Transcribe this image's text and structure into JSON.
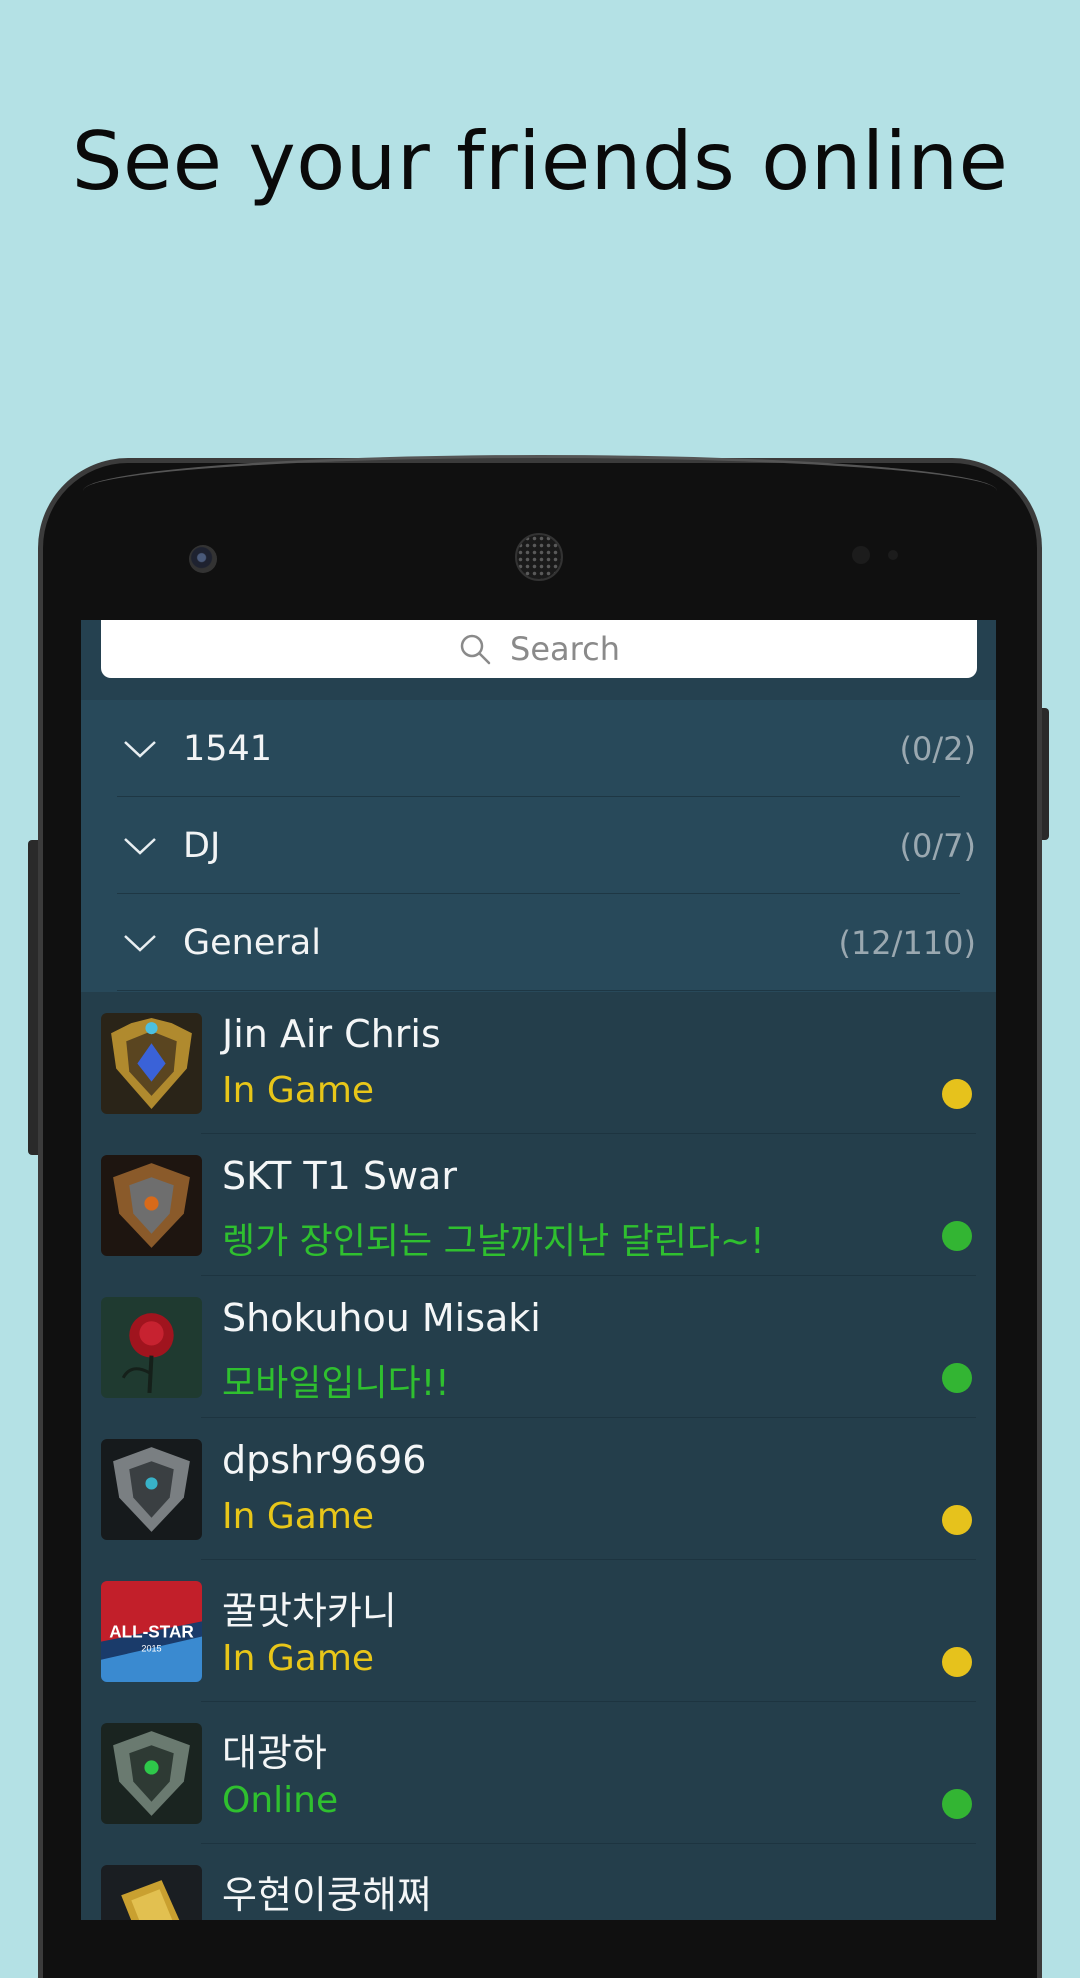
{
  "headline": "See your friends online",
  "search": {
    "placeholder": "Search",
    "icon": "search-icon"
  },
  "groups": [
    {
      "name": "1541",
      "count": "(0/2)"
    },
    {
      "name": "DJ",
      "count": "(0/7)"
    },
    {
      "name": "General",
      "count": "(12/110)"
    }
  ],
  "friends": [
    {
      "name": "Jin Air Chris",
      "status": "In Game",
      "status_color": "#e8c619",
      "dot_color": "#e6c21c",
      "avatar": "gold-shield-avatar"
    },
    {
      "name": "SKT T1 Swar",
      "status": "렝가 장인되는 그날까지난 달린다~!",
      "status_color": "#2fc02f",
      "dot_color": "#33b533",
      "avatar": "bronze-shield-avatar"
    },
    {
      "name": "Shokuhou Misaki",
      "status": "모바일입니다!!",
      "status_color": "#2fc02f",
      "dot_color": "#33b533",
      "avatar": "rose-avatar"
    },
    {
      "name": "dpshr9696",
      "status": "In Game",
      "status_color": "#e8c619",
      "dot_color": "#e6c21c",
      "avatar": "silver-shield-avatar"
    },
    {
      "name": "꿀맛차카니",
      "status": "In Game",
      "status_color": "#e8c619",
      "dot_color": "#e6c21c",
      "avatar": "all-star-avatar",
      "avatar_text": "ALL-STAR",
      "avatar_year": "2015"
    },
    {
      "name": "대광하",
      "status": "Online",
      "status_color": "#2fc02f",
      "dot_color": "#33b533",
      "avatar": "green-gem-shield-avatar"
    },
    {
      "name": "우현이쿵해쪄",
      "status": "",
      "status_color": "#e8c619",
      "dot_color": "",
      "avatar": "gold-card-avatar"
    }
  ],
  "colors": {
    "background": "#b4e1e5",
    "screen": "#243e4b",
    "groups_bg": "#28495a"
  }
}
